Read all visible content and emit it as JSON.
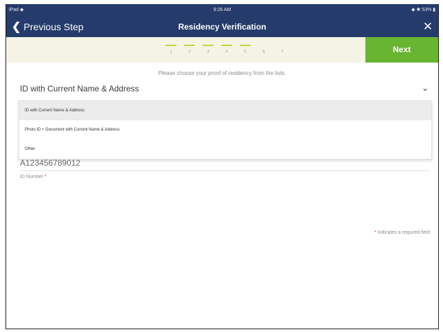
{
  "status": {
    "left": "iPad ◆",
    "time": "9:26 AM",
    "right": "◆ ✱ 53% ▮"
  },
  "nav": {
    "back_label": "Previous Step",
    "title": "Residency Verification",
    "close": "✕"
  },
  "steps": [
    {
      "num": "1",
      "done": true
    },
    {
      "num": "2",
      "done": true
    },
    {
      "num": "3",
      "done": true
    },
    {
      "num": "4",
      "done": true
    },
    {
      "num": "5",
      "done": true
    },
    {
      "num": "6",
      "done": false
    },
    {
      "num": "7",
      "done": false
    }
  ],
  "next_label": "Next",
  "instruction": "Please choose your proof of residency from the lists.",
  "select": {
    "value": "ID with Current Name & Address",
    "caret": "⌄"
  },
  "options": [
    {
      "label": "ID with Current Name & Address",
      "selected": true
    },
    {
      "label": "Photo ID + Document with Current Name & Address",
      "selected": false
    },
    {
      "label": "Other",
      "selected": false
    }
  ],
  "id_field": {
    "value": "A123456789012",
    "label": "ID Number",
    "required_mark": "*"
  },
  "required_note": {
    "mark": "*",
    "text": "Indicates a required field"
  },
  "colors": {
    "nav": "#253b6b",
    "accent_green": "#67b531",
    "step_done": "#c4d636",
    "stepbar_bg": "#f4f3e6"
  }
}
